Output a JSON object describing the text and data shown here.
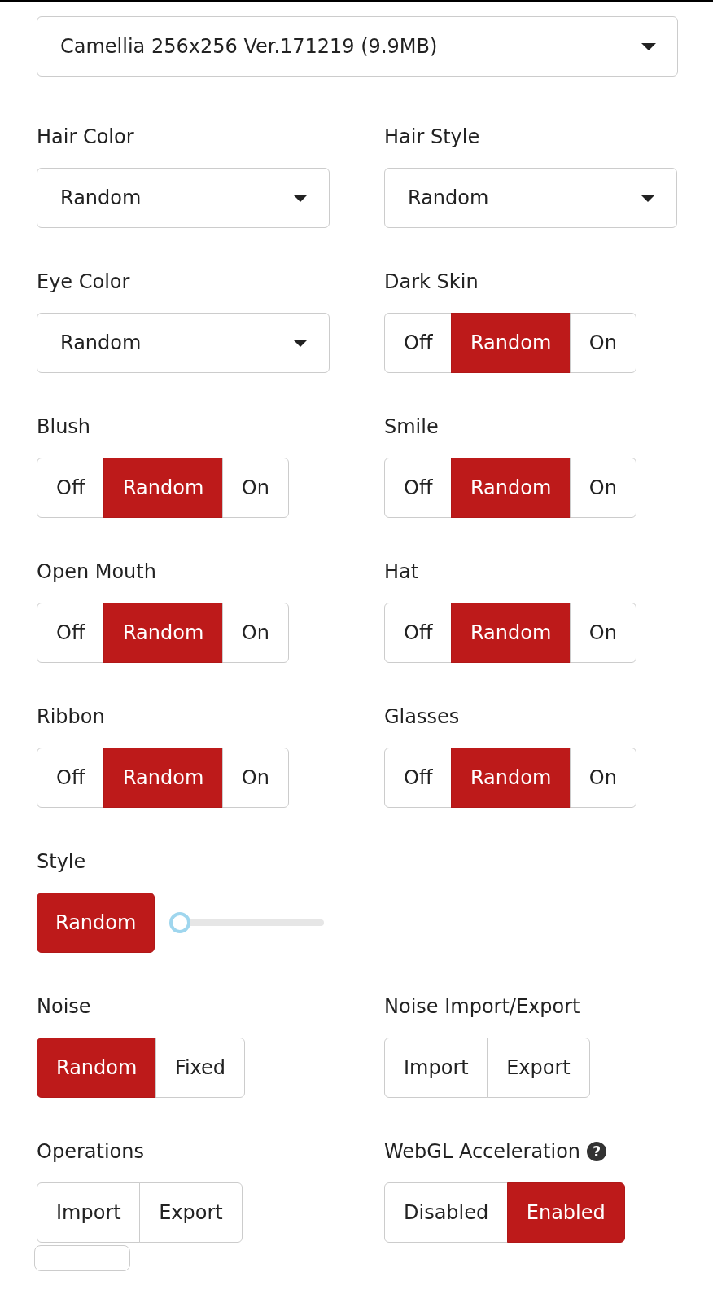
{
  "model_select": {
    "value": "Camellia 256x256 Ver.171219 (9.9MB)"
  },
  "fields": [
    {
      "kind": "dropdown",
      "label": "Hair Color",
      "value": "Random"
    },
    {
      "kind": "dropdown",
      "label": "Hair Style",
      "value": "Random"
    },
    {
      "kind": "dropdown",
      "label": "Eye Color",
      "value": "Random"
    },
    {
      "kind": "toggle",
      "label": "Dark Skin",
      "options": [
        {
          "label": "Off",
          "selected": false
        },
        {
          "label": "Random",
          "selected": true
        },
        {
          "label": "On",
          "selected": false
        }
      ]
    },
    {
      "kind": "toggle",
      "label": "Blush",
      "options": [
        {
          "label": "Off",
          "selected": false
        },
        {
          "label": "Random",
          "selected": true
        },
        {
          "label": "On",
          "selected": false
        }
      ]
    },
    {
      "kind": "toggle",
      "label": "Smile",
      "options": [
        {
          "label": "Off",
          "selected": false
        },
        {
          "label": "Random",
          "selected": true
        },
        {
          "label": "On",
          "selected": false
        }
      ]
    },
    {
      "kind": "toggle",
      "label": "Open Mouth",
      "options": [
        {
          "label": "Off",
          "selected": false
        },
        {
          "label": "Random",
          "selected": true
        },
        {
          "label": "On",
          "selected": false
        }
      ]
    },
    {
      "kind": "toggle",
      "label": "Hat",
      "options": [
        {
          "label": "Off",
          "selected": false
        },
        {
          "label": "Random",
          "selected": true
        },
        {
          "label": "On",
          "selected": false
        }
      ]
    },
    {
      "kind": "toggle",
      "label": "Ribbon",
      "options": [
        {
          "label": "Off",
          "selected": false
        },
        {
          "label": "Random",
          "selected": true
        },
        {
          "label": "On",
          "selected": false
        }
      ]
    },
    {
      "kind": "toggle",
      "label": "Glasses",
      "options": [
        {
          "label": "Off",
          "selected": false
        },
        {
          "label": "Random",
          "selected": true
        },
        {
          "label": "On",
          "selected": false
        }
      ]
    },
    {
      "kind": "slider",
      "label": "Style",
      "options": [
        {
          "label": "Random",
          "selected": true
        }
      ],
      "level": 0
    },
    {
      "kind": "empty"
    },
    {
      "kind": "toggle",
      "label": "Noise",
      "options": [
        {
          "label": "Random",
          "selected": true
        },
        {
          "label": "Fixed",
          "selected": false
        }
      ]
    },
    {
      "kind": "toggle",
      "label": "Noise Import/Export",
      "options": [
        {
          "label": "Import",
          "selected": false
        },
        {
          "label": "Export",
          "selected": false
        }
      ]
    },
    {
      "kind": "toggle",
      "label": "Operations",
      "options": [
        {
          "label": "Import",
          "selected": false
        },
        {
          "label": "Export",
          "selected": false
        }
      ]
    },
    {
      "kind": "toggle",
      "label": "WebGL Acceleration",
      "help": "?",
      "options": [
        {
          "label": "Disabled",
          "selected": false
        },
        {
          "label": "Enabled",
          "selected": true
        }
      ]
    }
  ]
}
